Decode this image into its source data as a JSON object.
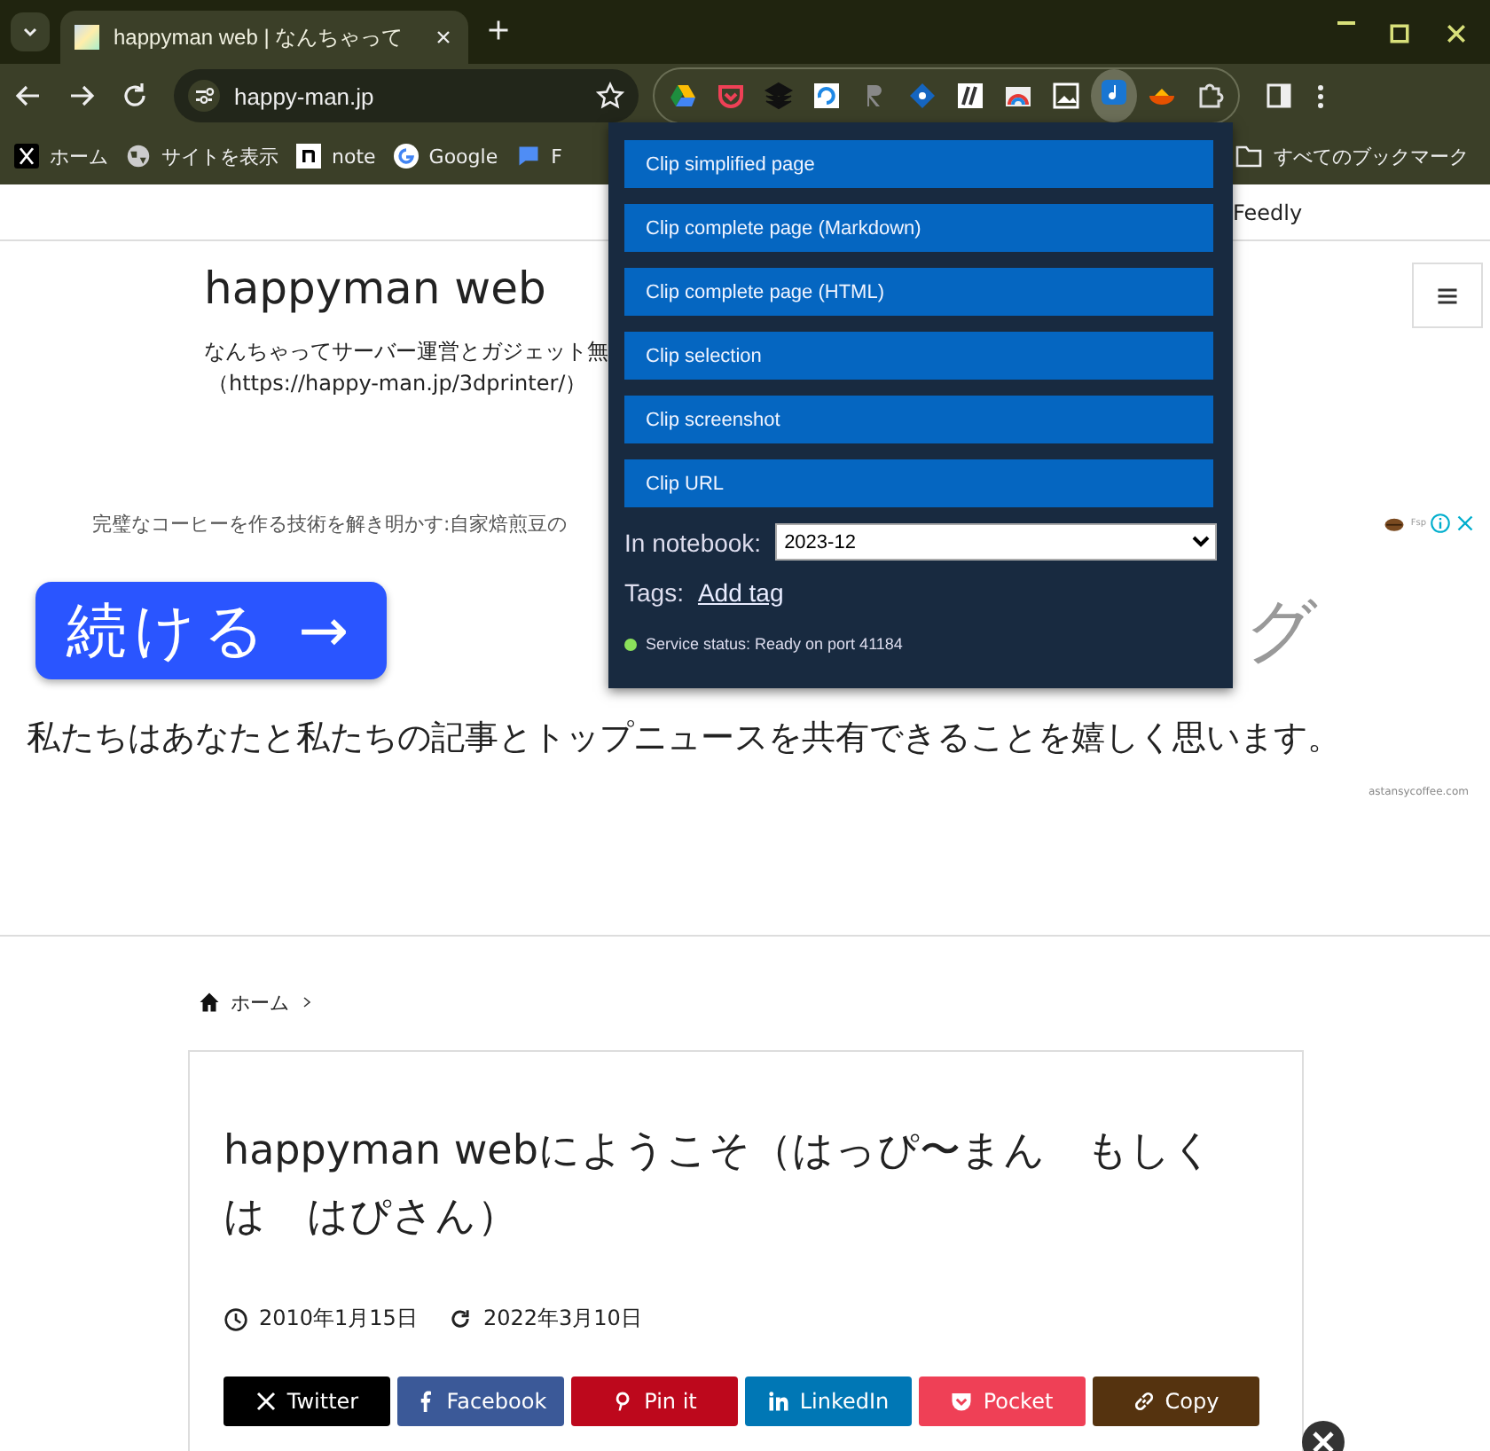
{
  "tabs": [
    {
      "title": "happyman web | なんちゃって",
      "selected": true
    }
  ],
  "address_bar": {
    "url": "happy-man.jp"
  },
  "bookmarks": [
    {
      "label": "ホーム",
      "kind": "x"
    },
    {
      "label": "サイトを表示",
      "kind": "globe"
    },
    {
      "label": "note",
      "kind": "note"
    },
    {
      "label": "Google",
      "kind": "google"
    },
    {
      "label": "F",
      "kind": "chat"
    }
  ],
  "all_bookmarks": "すべてのブックマーク",
  "page": {
    "nav_item": "Feedly",
    "site_title": "happyman web",
    "tagline": "なんちゃってサーバー運営とガジェット無",
    "tagline_url": "（https://happy-man.jp/3dprinter/）",
    "ad": {
      "headline": "完璧なコーヒーを作る技術を解き明かす:自家焙煎豆の",
      "label": "Fsp",
      "button": "続ける →",
      "partial_heading": "グ",
      "message": "私たちはあなたと私たちの記事とトップニュースを共有できることを嬉しく思います。",
      "domain": "astansycoffee.com"
    },
    "breadcrumb": [
      {
        "label": "ホーム"
      }
    ],
    "article": {
      "title": "happyman webにようこそ（はっぴ〜まん　もしくは　はぴさん）",
      "published": "2010年1月15日",
      "updated": "2022年3月10日",
      "share_buttons": [
        {
          "label": "Twitter",
          "kind": "x",
          "color": "#000000"
        },
        {
          "label": "Facebook",
          "kind": "facebook",
          "color": "#3b5998"
        },
        {
          "label": "Pin it",
          "kind": "pinterest",
          "color": "#bd081c"
        },
        {
          "label": "LinkedIn",
          "kind": "linkedin",
          "color": "#0077b5"
        },
        {
          "label": "Pocket",
          "kind": "pocket",
          "color": "#ef4056"
        },
        {
          "label": "Copy",
          "kind": "link",
          "color": "#55330f"
        }
      ]
    }
  },
  "clipper_popup": {
    "actions": [
      "Clip simplified page",
      "Clip complete page (Markdown)",
      "Clip complete page (HTML)",
      "Clip selection",
      "Clip screenshot",
      "Clip URL"
    ],
    "notebook_label": "In notebook:",
    "notebook": "2023-12",
    "tags_label": "Tags:",
    "add_tag": "Add tag",
    "status": "Service status: Ready on port 41184"
  }
}
